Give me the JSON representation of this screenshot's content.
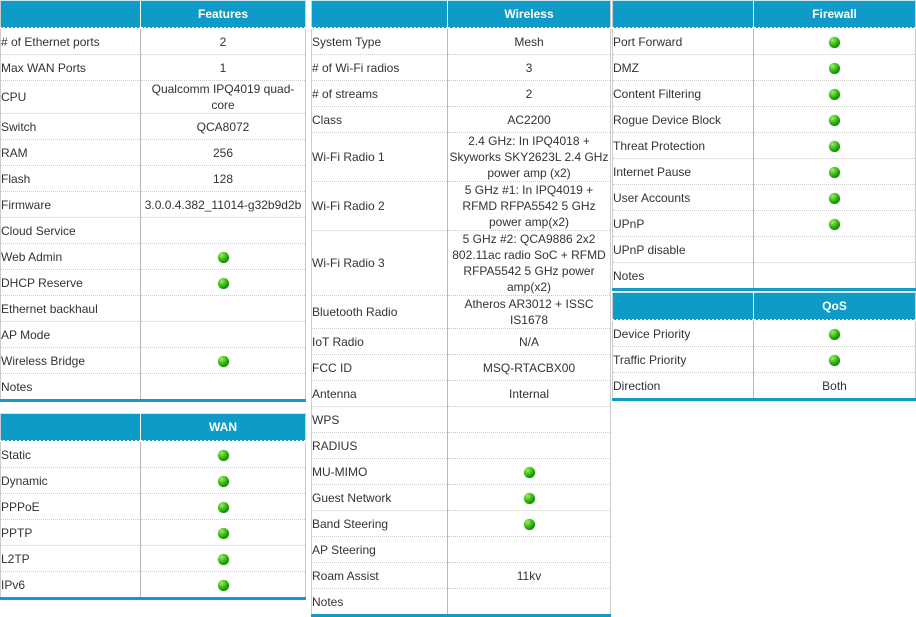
{
  "colors": {
    "header_blue": "#0f9bc8",
    "header_text": "#ffffff",
    "body_text": "#333333",
    "status_green": "#129b06",
    "rule": "#cccccc"
  },
  "icons": {
    "supported": "green-status-dot"
  },
  "tables": {
    "features": {
      "header": {
        "label_col": "",
        "value_col": "Features"
      },
      "rows": [
        {
          "label": "# of Ethernet ports",
          "value": "2",
          "type": "text"
        },
        {
          "label": "Max WAN Ports",
          "value": "1",
          "type": "text"
        },
        {
          "label": "CPU",
          "value": "Qualcomm IPQ4019 quad-core",
          "type": "text"
        },
        {
          "label": "Switch",
          "value": "QCA8072",
          "type": "text"
        },
        {
          "label": "RAM",
          "value": "256",
          "type": "text"
        },
        {
          "label": "Flash",
          "value": "128",
          "type": "text"
        },
        {
          "label": "Firmware",
          "value": "3.0.0.4.382_11014-g32b9d2b",
          "type": "text"
        },
        {
          "label": "Cloud Service",
          "value": "",
          "type": "text"
        },
        {
          "label": "Web Admin",
          "value": "",
          "type": "dot"
        },
        {
          "label": "DHCP Reserve",
          "value": "",
          "type": "dot"
        },
        {
          "label": "Ethernet backhaul",
          "value": "",
          "type": "text"
        },
        {
          "label": "AP Mode",
          "value": "",
          "type": "text"
        },
        {
          "label": "Wireless Bridge",
          "value": "",
          "type": "dot"
        },
        {
          "label": "Notes",
          "value": "",
          "type": "text"
        }
      ]
    },
    "wan": {
      "header": {
        "label_col": "",
        "value_col": "WAN"
      },
      "rows": [
        {
          "label": "Static",
          "value": "",
          "type": "dot"
        },
        {
          "label": "Dynamic",
          "value": "",
          "type": "dot"
        },
        {
          "label": "PPPoE",
          "value": "",
          "type": "dot"
        },
        {
          "label": "PPTP",
          "value": "",
          "type": "dot"
        },
        {
          "label": "L2TP",
          "value": "",
          "type": "dot"
        },
        {
          "label": "IPv6",
          "value": "",
          "type": "dot"
        }
      ]
    },
    "wireless": {
      "header": {
        "label_col": "",
        "value_col": "Wireless"
      },
      "rows": [
        {
          "label": "System Type",
          "value": "Mesh",
          "type": "text"
        },
        {
          "label": "# of Wi-Fi radios",
          "value": "3",
          "type": "text"
        },
        {
          "label": "# of streams",
          "value": "2",
          "type": "text"
        },
        {
          "label": "Class",
          "value": "AC2200",
          "type": "text"
        },
        {
          "label": "Wi-Fi Radio 1",
          "value": "2.4 GHz: In IPQ4018 + Skyworks SKY2623L 2.4 GHz power amp (x2)",
          "type": "text"
        },
        {
          "label": "Wi-Fi Radio 2",
          "value": "5 GHz #1: In IPQ4019 + RFMD RFPA5542 5 GHz power amp(x2)",
          "type": "text"
        },
        {
          "label": "Wi-Fi Radio 3",
          "value": "5 GHz #2: QCA9886 2x2 802.11ac radio SoC + RFMD RFPA5542 5 GHz power amp(x2)",
          "type": "text"
        },
        {
          "label": "Bluetooth Radio",
          "value": "Atheros AR3012 + ISSC IS1678",
          "type": "text"
        },
        {
          "label": "IoT Radio",
          "value": "N/A",
          "type": "text"
        },
        {
          "label": "FCC ID",
          "value": "MSQ-RTACBX00",
          "type": "text"
        },
        {
          "label": "Antenna",
          "value": "Internal",
          "type": "text"
        },
        {
          "label": "WPS",
          "value": "",
          "type": "text"
        },
        {
          "label": "RADIUS",
          "value": "",
          "type": "text"
        },
        {
          "label": "MU-MIMO",
          "value": "",
          "type": "dot"
        },
        {
          "label": "Guest Network",
          "value": "",
          "type": "dot"
        },
        {
          "label": "Band Steering",
          "value": "",
          "type": "dot"
        },
        {
          "label": "AP Steering",
          "value": "",
          "type": "text"
        },
        {
          "label": "Roam Assist",
          "value": "11kv",
          "type": "text"
        },
        {
          "label": "Notes",
          "value": "",
          "type": "text"
        }
      ]
    },
    "firewall": {
      "header": {
        "label_col": "",
        "value_col": "Firewall"
      },
      "rows": [
        {
          "label": "Port Forward",
          "value": "",
          "type": "dot"
        },
        {
          "label": "DMZ",
          "value": "",
          "type": "dot"
        },
        {
          "label": "Content Filtering",
          "value": "",
          "type": "dot"
        },
        {
          "label": "Rogue Device Block",
          "value": "",
          "type": "dot"
        },
        {
          "label": "Threat Protection",
          "value": "",
          "type": "dot"
        },
        {
          "label": "Internet Pause",
          "value": "",
          "type": "dot"
        },
        {
          "label": "User Accounts",
          "value": "",
          "type": "dot"
        },
        {
          "label": "UPnP",
          "value": "",
          "type": "dot"
        },
        {
          "label": "UPnP disable",
          "value": "",
          "type": "text"
        },
        {
          "label": "Notes",
          "value": "",
          "type": "text"
        }
      ]
    },
    "qos": {
      "header": {
        "label_col": "",
        "value_col": "QoS"
      },
      "rows": [
        {
          "label": "Device Priority",
          "value": "",
          "type": "dot"
        },
        {
          "label": "Traffic Priority",
          "value": "",
          "type": "dot"
        },
        {
          "label": "Direction",
          "value": "Both",
          "type": "text"
        }
      ]
    }
  }
}
